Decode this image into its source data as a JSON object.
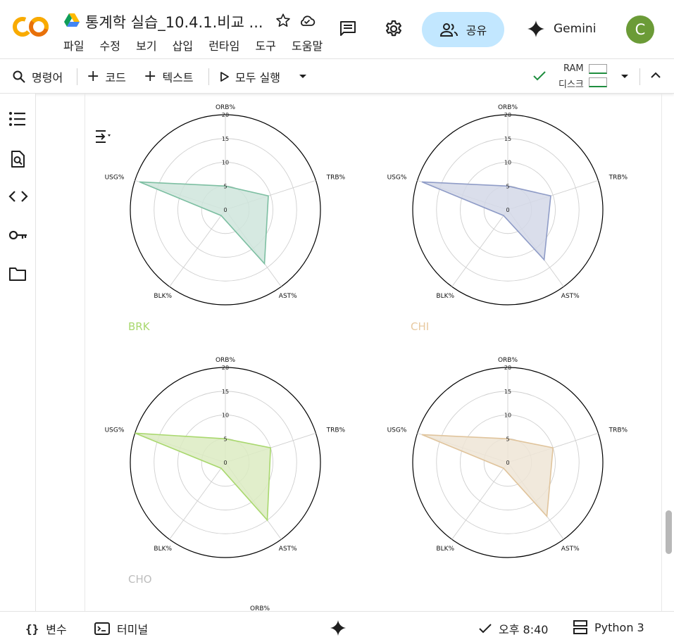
{
  "header": {
    "doc_title": "통계학 실습_10.4.1.비교 ...",
    "menu": [
      "파일",
      "수정",
      "보기",
      "삽입",
      "런타임",
      "도구",
      "도움말"
    ],
    "share_label": "공유",
    "gemini_label": "Gemini",
    "avatar_letter": "C",
    "accent_color": "#c2e7ff",
    "avatar_color": "#6b9b37"
  },
  "toolbar": {
    "commands_label": "명령어",
    "code_label": "코드",
    "text_label": "텍스트",
    "run_all_label": "모두 실행",
    "ram_label": "RAM",
    "disk_label": "디스크"
  },
  "sidebar": {
    "icons": [
      "table-of-contents-icon",
      "find-replace-icon",
      "code-snippets-icon",
      "secrets-key-icon",
      "files-folder-icon"
    ]
  },
  "statusbar": {
    "variables_label": "변수",
    "terminal_label": "터미널",
    "time_label": "오후 8:40",
    "runtime_label": "Python 3"
  },
  "chart_data": [
    {
      "type": "radar",
      "team": "BRK",
      "color": "#a9d86e",
      "fill": "#cfe5dc",
      "stroke": "#7dbfa2",
      "axes": [
        "ORB%",
        "TRB%",
        "AST%",
        "BLK%",
        "USG%"
      ],
      "values": [
        5,
        9.5,
        14,
        1.5,
        19
      ],
      "rlim": [
        0,
        20
      ],
      "rticks": [
        0,
        5,
        10,
        15,
        20
      ]
    },
    {
      "type": "radar",
      "team": "CHI",
      "color": "#e8c9a0",
      "fill": "#d3d8e8",
      "stroke": "#8f9cc7",
      "axes": [
        "ORB%",
        "TRB%",
        "AST%",
        "BLK%",
        "USG%"
      ],
      "values": [
        5,
        9.5,
        13,
        1.5,
        19
      ],
      "rlim": [
        0,
        20
      ],
      "rticks": [
        0,
        5,
        10,
        15,
        20
      ]
    },
    {
      "type": "radar",
      "team": "CHO",
      "color": "#bdbdbd",
      "fill": "#dcebc2",
      "stroke": "#a9d86e",
      "axes": [
        "ORB%",
        "TRB%",
        "AST%",
        "BLK%",
        "USG%"
      ],
      "values": [
        5,
        10,
        15,
        1.5,
        20
      ],
      "rlim": [
        0,
        20
      ],
      "rticks": [
        0,
        5,
        10,
        15,
        20
      ]
    },
    {
      "type": "radar",
      "team": "",
      "color": "#e8c9a0",
      "fill": "#eee5d6",
      "stroke": "#e0c49c",
      "axes": [
        "ORB%",
        "TRB%",
        "AST%",
        "BLK%",
        "USG%"
      ],
      "values": [
        5,
        10,
        14,
        1.5,
        19
      ],
      "rlim": [
        0,
        20
      ],
      "rticks": [
        0,
        5,
        10,
        15,
        20
      ]
    }
  ],
  "partial_next_label": "ORB%"
}
